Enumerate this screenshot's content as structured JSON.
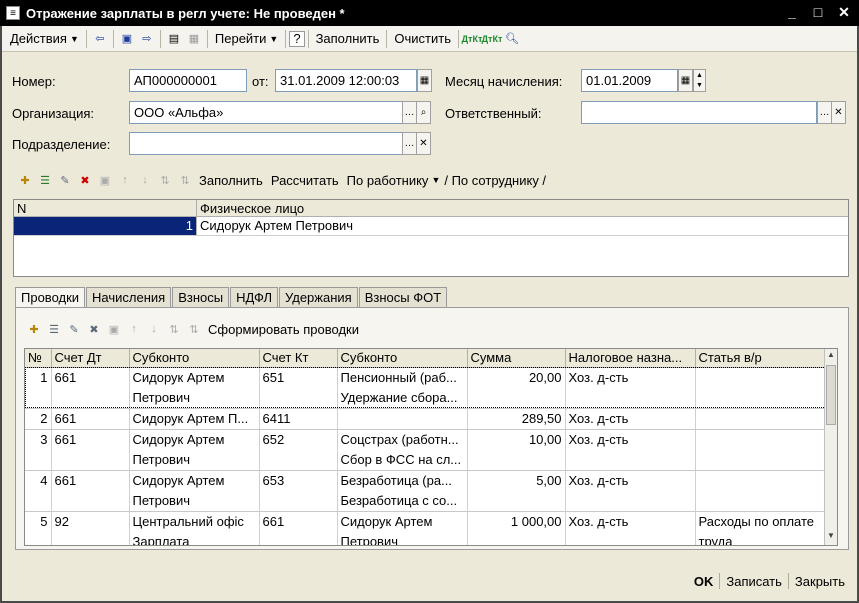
{
  "window": {
    "title": "Отражение зарплаты в регл учете: Не проведен *"
  },
  "toolbar": {
    "actions_label": "Действия",
    "goto_label": "Перейти",
    "help_label": "?",
    "fill_label": "Заполнить",
    "clear_label": "Очистить"
  },
  "form": {
    "number_label": "Номер:",
    "number_value": "АП000000001",
    "from_label": "от:",
    "date_value": "31.01.2009 12:00:03",
    "month_label": "Месяц начисления:",
    "month_value": "01.01.2009",
    "org_label": "Организация:",
    "org_value": "ООО «Альфа»",
    "resp_label": "Ответственный:",
    "resp_value": "",
    "dept_label": "Подразделение:",
    "dept_value": ""
  },
  "emp_toolbar": {
    "fill_label": "Заполнить",
    "calc_label": "Рассчитать",
    "by_worker_label": "По работнику",
    "by_employee_label": "/ По сотруднику /"
  },
  "employees": {
    "columns": [
      "N",
      "Физическое лицо"
    ],
    "rows": [
      {
        "n": "1",
        "person": "Сидорук Артем Петрович"
      }
    ]
  },
  "tabs": [
    "Проводки",
    "Начисления",
    "Взносы",
    "НДФЛ",
    "Удержания",
    "Взносы ФОТ"
  ],
  "postings_toolbar": {
    "form_label": "Сформировать проводки"
  },
  "postings": {
    "columns": [
      "№",
      "Счет Дт",
      "Субконто",
      "Счет Кт",
      "Субконто",
      "Сумма",
      "Налоговое назна...",
      "Статья в/р"
    ],
    "rows": [
      {
        "n": "1",
        "dt": "661",
        "sub_dt": "Сидорук Артем",
        "sub_dt2": "Петрович",
        "kt": "651",
        "sub_kt": "Пенсионный (раб...",
        "sub_kt2": "Удержание сбора...",
        "sum": "20,00",
        "tax": "Хоз. д-сть",
        "art": "",
        "art2": ""
      },
      {
        "n": "2",
        "dt": "661",
        "sub_dt": "Сидорук Артем П...",
        "sub_dt2": "",
        "kt": "6411",
        "sub_kt": "",
        "sub_kt2": "",
        "sum": "289,50",
        "tax": "Хоз. д-сть",
        "art": "",
        "art2": ""
      },
      {
        "n": "3",
        "dt": "661",
        "sub_dt": "Сидорук Артем",
        "sub_dt2": "Петрович",
        "kt": "652",
        "sub_kt": "Соцстрах (работн...",
        "sub_kt2": "Сбор в ФСС на сл...",
        "sum": "10,00",
        "tax": "Хоз. д-сть",
        "art": "",
        "art2": ""
      },
      {
        "n": "4",
        "dt": "661",
        "sub_dt": "Сидорук Артем",
        "sub_dt2": "Петрович",
        "kt": "653",
        "sub_kt": "Безработица (ра...",
        "sub_kt2": "Безработица с со...",
        "sum": "5,00",
        "tax": "Хоз. д-сть",
        "art": "",
        "art2": ""
      },
      {
        "n": "5",
        "dt": "92",
        "sub_dt": "Центральний офіс",
        "sub_dt2": "Зарплата",
        "kt": "661",
        "sub_kt": "Сидорук Артем",
        "sub_kt2": "Петрович",
        "sum": "1 000,00",
        "tax": "Хоз. д-сть",
        "art": "Расходы по оплате",
        "art2": "труда"
      }
    ]
  },
  "bottom": {
    "ok_label": "OK",
    "save_label": "Записать",
    "close_label": "Закрыть"
  }
}
